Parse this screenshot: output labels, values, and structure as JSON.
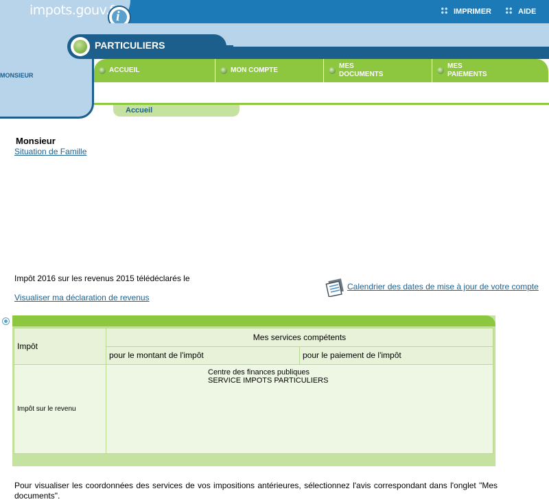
{
  "header": {
    "logo_text": "impots.gouv.fr",
    "logo_badge": "i",
    "links": {
      "print": "IMPRIMER",
      "help": "AIDE"
    }
  },
  "sidebar": {
    "user_label": "MONSIEUR"
  },
  "section": {
    "title": "PARTICULIERS"
  },
  "nav": {
    "tabs": [
      {
        "label": "ACCUEIL"
      },
      {
        "label": "MON COMPTE"
      },
      {
        "label": "MES\nDOCUMENTS"
      },
      {
        "label": "MES\nPAIEMENTS"
      }
    ]
  },
  "breadcrumb": "Accueil",
  "user": {
    "name": "Monsieur",
    "family_link": "Situation de Famille"
  },
  "tax": {
    "title": "Impôt 2016 sur les revenus 2015 télédéclarés le",
    "declaration_link": "Visualiser ma déclaration de revenus",
    "calendar_link": "Calendrier des dates de mise à jour de votre compte"
  },
  "services_table": {
    "col_tax": "Impôt",
    "col_services": "Mes services compétents",
    "col_amount": "pour le montant de l'impôt",
    "col_payment": "pour le paiement de l'impôt",
    "rows": [
      {
        "tax": "Impôt sur le revenu",
        "service_line1": "Centre des finances publiques",
        "service_line2": "SERVICE IMPOTS PARTICULIERS"
      }
    ]
  },
  "footer_note": "Pour visualiser les coordonnées des services de vos impositions antérieures, sélectionnez l'avis correspondant dans l'onglet \"Mes documents\".",
  "colors": {
    "header_blue": "#1c7ab6",
    "dark_blue": "#1c5f8c",
    "light_blue": "#b7d4ea",
    "nav_green": "#8dc63f",
    "pale_green": "#c5e2a0",
    "link": "#1c5f8c"
  }
}
